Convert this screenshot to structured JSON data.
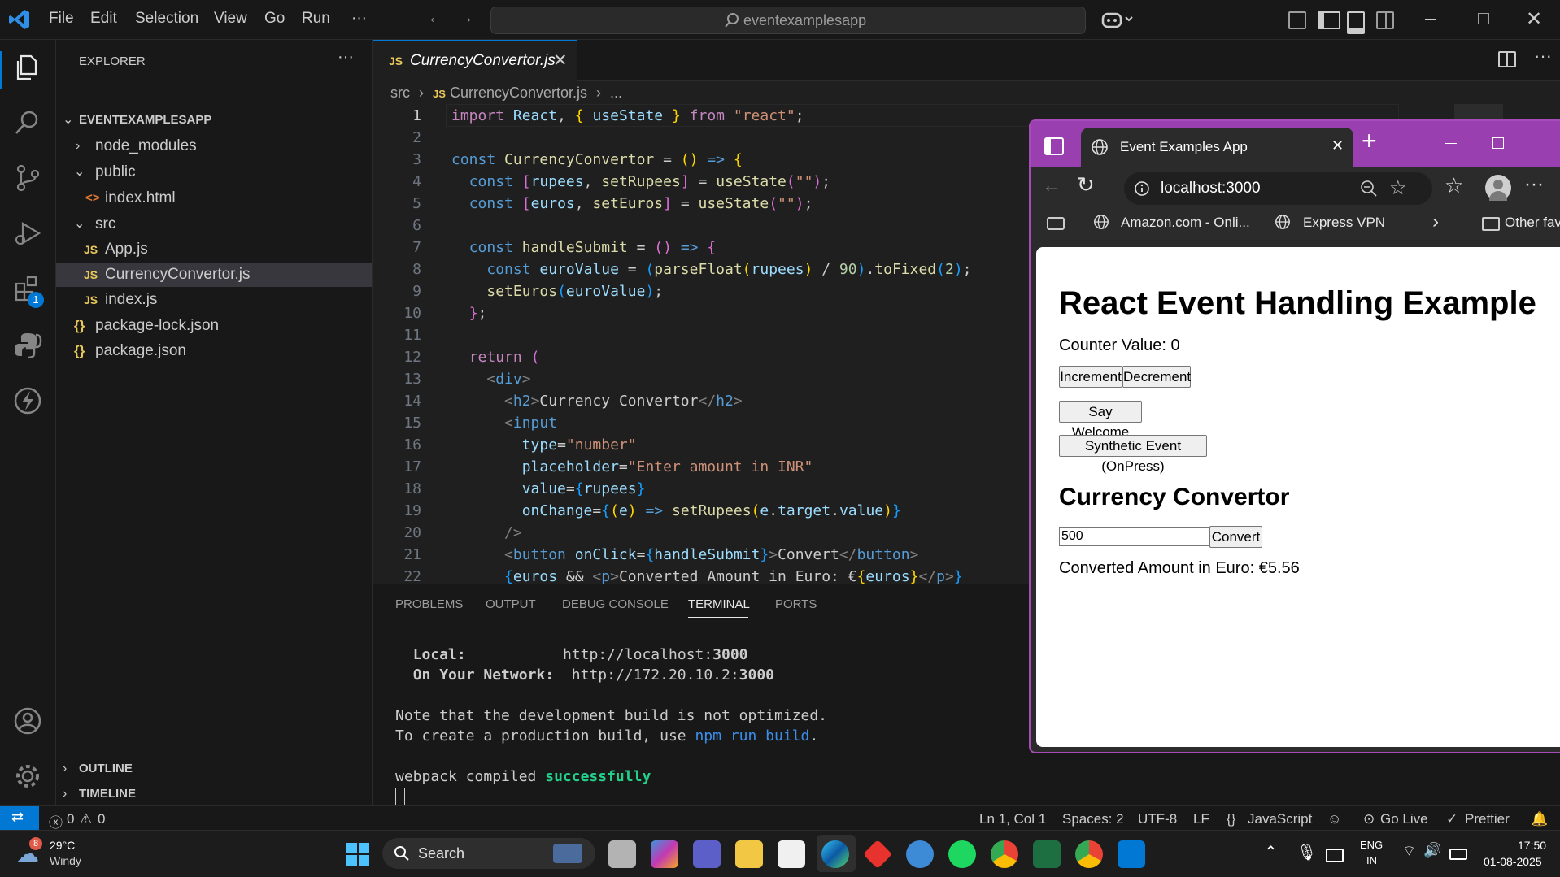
{
  "titlebar": {
    "menu": [
      "File",
      "Edit",
      "Selection",
      "View",
      "Go",
      "Run",
      "···"
    ],
    "search_text": "eventexamplesapp"
  },
  "activity": {
    "extensions_badge": "1"
  },
  "explorer": {
    "title": "EXPLORER",
    "more": "···",
    "project": "EVENTEXAMPLESAPP",
    "items": [
      {
        "label": "node_modules",
        "type": "folder-collapsed"
      },
      {
        "label": "public",
        "type": "folder-open"
      },
      {
        "label": "index.html",
        "type": "html"
      },
      {
        "label": "src",
        "type": "folder-open"
      },
      {
        "label": "App.js",
        "type": "js"
      },
      {
        "label": "CurrencyConvertor.js",
        "type": "js"
      },
      {
        "label": "index.js",
        "type": "js"
      },
      {
        "label": "package-lock.json",
        "type": "json"
      },
      {
        "label": "package.json",
        "type": "json"
      }
    ],
    "outline": "OUTLINE",
    "timeline": "TIMELINE"
  },
  "editor": {
    "tab_label": "CurrencyConvertor.js",
    "breadcrumb": [
      "src",
      "CurrencyConvertor.js",
      "..."
    ],
    "line_numbers": [
      "1",
      "2",
      "3",
      "4",
      "5",
      "6",
      "7",
      "8",
      "9",
      "10",
      "11",
      "12",
      "13",
      "14",
      "15",
      "16",
      "17",
      "18",
      "19",
      "20",
      "21",
      "22"
    ]
  },
  "panel": {
    "tabs": [
      "PROBLEMS",
      "OUTPUT",
      "DEBUG CONSOLE",
      "TERMINAL",
      "PORTS"
    ],
    "active_tab": "TERMINAL",
    "terminal": {
      "local_label": "Local:",
      "local_url_prefix": "http://localhost:",
      "local_port": "3000",
      "network_label": "On Your Network:",
      "network_url_prefix": "http://172.20.10.2:",
      "network_port": "3000",
      "note1": "Note that the development build is not optimized.",
      "note2_prefix": "To create a production build, use ",
      "note2_cmd": "npm run build",
      "note2_suffix": ".",
      "webpack_prefix": "webpack compiled ",
      "webpack_status": "successfully"
    }
  },
  "statusbar": {
    "errors": "0",
    "warnings": "0",
    "position": "Ln 1, Col 1",
    "spaces": "Spaces: 2",
    "encoding": "UTF-8",
    "eol": "LF",
    "language": "JavaScript",
    "golive": "Go Live",
    "prettier": "Prettier"
  },
  "browser": {
    "tab_title": "Event Examples App",
    "url": "localhost:3000",
    "bookmarks": [
      "Amazon.com - Onli...",
      "Express VPN",
      "Other fav"
    ],
    "page": {
      "h1": "React Event Handling Example",
      "counter": "Counter Value: 0",
      "increment": "Increment",
      "decrement": "Decrement",
      "say_welcome": "Say Welcome",
      "synthetic": "Synthetic Event (OnPress)",
      "h2": "Currency Convertor",
      "input_value": "500",
      "convert": "Convert",
      "converted": "Converted Amount in Euro: €5.56"
    }
  },
  "taskbar": {
    "weather_badge": "8",
    "temp": "29°C",
    "condition": "Windy",
    "search": "Search",
    "lang1": "ENG",
    "lang2": "IN",
    "time": "17:50",
    "date": "01-08-2025"
  }
}
